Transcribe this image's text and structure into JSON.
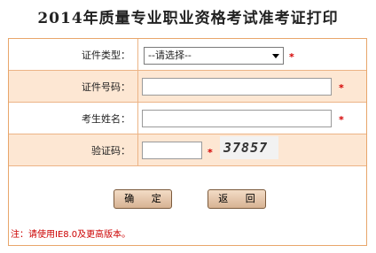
{
  "page": {
    "title": "2014年质量专业职业资格考试准考证打印"
  },
  "form": {
    "id_type": {
      "label": "证件类型：",
      "selected": "--请选择--",
      "required": "*"
    },
    "id_number": {
      "label": "证件号码：",
      "value": "",
      "required": "*"
    },
    "name": {
      "label": "考生姓名：",
      "value": "",
      "required": "*"
    },
    "captcha": {
      "label": "验证码：",
      "value": "",
      "required": "*",
      "image_text": "37857"
    }
  },
  "buttons": {
    "confirm": "确 定",
    "back": "返 回"
  },
  "note": "注：请使用IE8.0及更高版本。",
  "colors": {
    "border": "#e8a66b",
    "shaded_row": "#fde7d3",
    "required": "#d40000"
  }
}
